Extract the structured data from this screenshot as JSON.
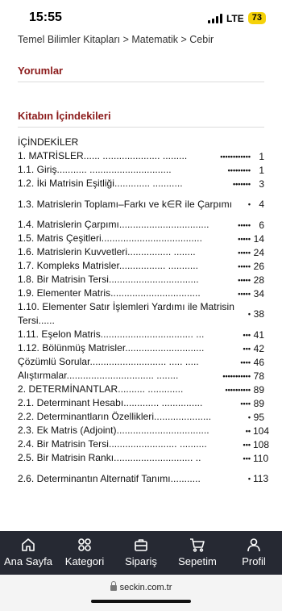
{
  "status_bar": {
    "time": "15:55",
    "network": "LTE",
    "battery": "73",
    "battery_color": "#f5d20a"
  },
  "breadcrumb": "Temel Bilimler Kitapları > Matematik > Cebir",
  "sections": {
    "reviews_title": "Yorumlar",
    "contents_title": "Kitabın İçindekileri"
  },
  "accent_color": "#8b1a1a",
  "toc": {
    "heading": "İÇİNDEKİLER",
    "entries": [
      {
        "text": "1. MATRİSLER...... ..................... .........",
        "dots": "••••••••••••",
        "page": "1"
      },
      {
        "text": "1.1. Giriş........... ..............................",
        "dots": "•••••••••",
        "page": "1"
      },
      {
        "text": "1.2. İki Matrisin Eşitliği............. ...........",
        "dots": "•••••••",
        "page": "3"
      },
      {
        "text": "1.3. Matrislerin Toplamı–Farkı ve k∈R ile Çarpımı",
        "dots": "•",
        "page": "4"
      },
      {
        "text": "1.4. Matrislerin Çarpımı.................................",
        "dots": "•••••",
        "page": "6"
      },
      {
        "text": "1.5. Matris Çeşitleri.....................................",
        "dots": "•••••",
        "page": "14"
      },
      {
        "text": "1.6. Matrislerin Kuvvetleri................ ........",
        "dots": "•••••",
        "page": "24"
      },
      {
        "text": "1.7. Kompleks Matrisler................. ...........",
        "dots": "•••••",
        "page": "26"
      },
      {
        "text": "1.8. Bir Matrisin Tersi.................................",
        "dots": "•••••",
        "page": "28"
      },
      {
        "text": "1.9. Elementer Matris.................................",
        "dots": "•••••",
        "page": "34"
      },
      {
        "text": "1.10. Elementer Satır İşlemleri Yardımı ile Matrisin Tersi......",
        "dots": "•",
        "page": "38"
      },
      {
        "text": "1.11. Eşelon Matris.................................. ...",
        "dots": "•••",
        "page": "41"
      },
      {
        "text": "1.12. Bölünmüş Matrisler.............................",
        "dots": "•••",
        "page": "42"
      },
      {
        "text": "Çözümlü Sorular............................ ..... .....",
        "dots": "••••",
        "page": "46"
      },
      {
        "text": "Alıştırmalar................................ ........",
        "dots": "•••••••••••",
        "page": "78"
      },
      {
        "text": "2. DETERMİNANTLAR.......... .............",
        "dots": "••••••••••",
        "page": "89"
      },
      {
        "text": "2.1. Determinant Hesabı............. ...............",
        "dots": "••••",
        "page": "89"
      },
      {
        "text": "2.2. Determinantların Özellikleri.....................",
        "dots": "•",
        "page": "95"
      },
      {
        "text": "2.3. Ek Matris (Adjoint)..................................",
        "dots": "••",
        "page": "104"
      },
      {
        "text": "2.4. Bir Matrisin Tersi......................... ..........",
        "dots": "•••",
        "page": "108"
      },
      {
        "text": "2.5. Bir Matrisin Rankı............................. ..",
        "dots": "•••",
        "page": "110"
      },
      {
        "text": "2.6. Determinantın Alternatif Tanımı...........",
        "dots": "•",
        "page": "113"
      }
    ]
  },
  "bottom_nav": {
    "items": [
      {
        "label": "Ana Sayfa",
        "icon": "home-icon"
      },
      {
        "label": "Kategori",
        "icon": "grid-icon"
      },
      {
        "label": "Sipariş",
        "icon": "briefcase-icon"
      },
      {
        "label": "Sepetim",
        "icon": "cart-icon"
      },
      {
        "label": "Profil",
        "icon": "user-icon"
      }
    ]
  },
  "url_bar": {
    "url": "seckin.com.tr"
  }
}
